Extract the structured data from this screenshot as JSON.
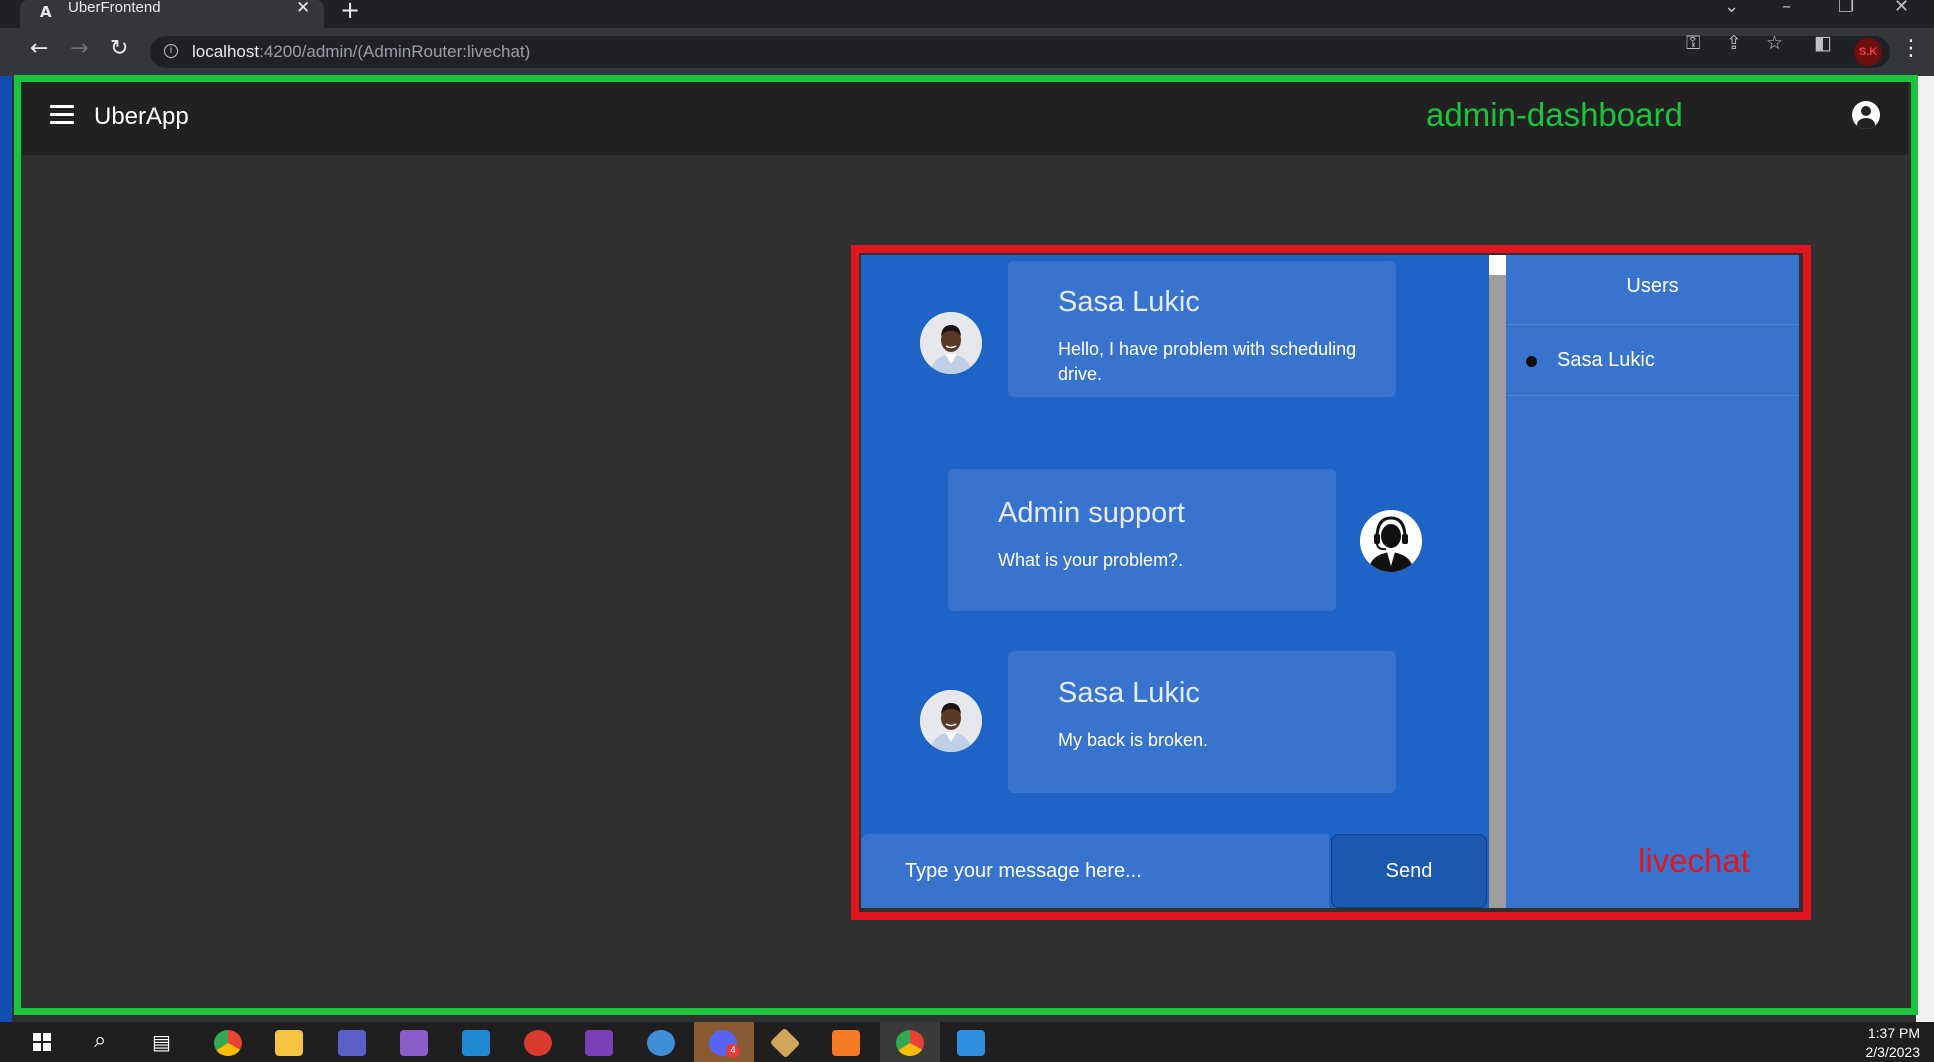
{
  "browser": {
    "tab_title": "UberFrontend",
    "tab_favicon": "A",
    "url_host": "localhost",
    "url_path": ":4200/admin/(AdminRouter:livechat)",
    "profile_initials": "S.K"
  },
  "app": {
    "title": "UberApp",
    "dashboard_label": "admin-dashboard",
    "component_label": "livechat"
  },
  "chat": {
    "messages": [
      {
        "sender": "Sasa Lukic",
        "text": "Hello, I have problem with scheduling drive.",
        "side": "left"
      },
      {
        "sender": "Admin support",
        "text": "What is your problem?.",
        "side": "right"
      },
      {
        "sender": "Sasa Lukic",
        "text": "My back is broken.",
        "side": "left"
      }
    ],
    "input_placeholder": "Type your message here...",
    "send_label": "Send"
  },
  "users": {
    "title": "Users",
    "list": [
      {
        "name": "Sasa Lukic",
        "status": "online"
      }
    ]
  },
  "taskbar": {
    "time": "1:37 PM",
    "date": "2/3/2023",
    "discord_badge": "4"
  },
  "colors": {
    "dashboard_frame": "#1bc43c",
    "livechat_frame": "#e3161f",
    "chat_bg": "#1e63c6",
    "bubble_bg": "#3874ce",
    "toolbar_bg": "#212121",
    "page_bg": "#303030"
  }
}
